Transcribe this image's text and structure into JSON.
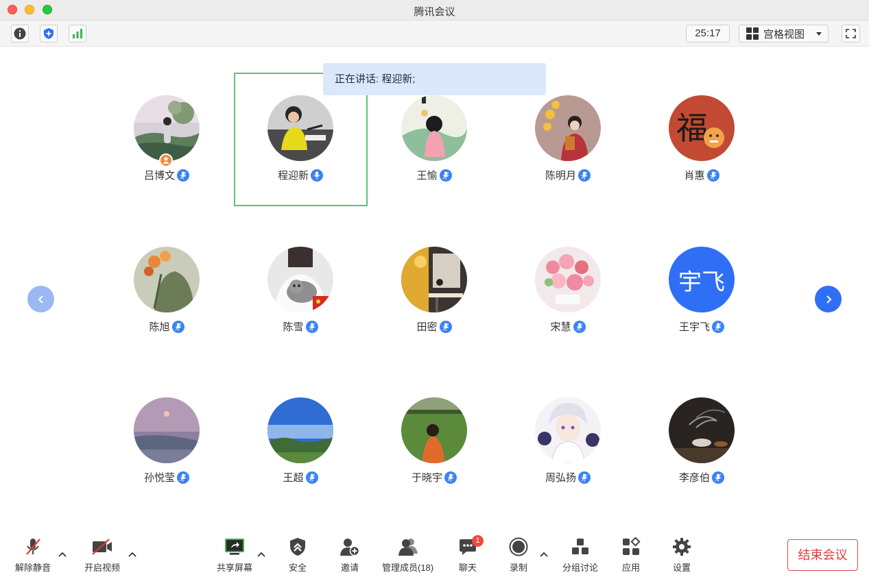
{
  "window": {
    "title": "腾讯会议"
  },
  "toolbar": {
    "timer": "25:17",
    "view_mode": "宫格视图"
  },
  "speaking_banner": "正在讲话: 程迎新;",
  "participants": [
    {
      "name": "吕博文",
      "avatar": "landscape-photo",
      "host": true
    },
    {
      "name": "程迎新",
      "avatar": "person-photo",
      "speaking": true
    },
    {
      "name": "王愉",
      "avatar": "illustration"
    },
    {
      "name": "陈明月",
      "avatar": "illustration"
    },
    {
      "name": "肖惠",
      "avatar": "fu-character"
    },
    {
      "name": "陈旭",
      "avatar": "flowers-photo"
    },
    {
      "name": "陈雪",
      "avatar": "cat-photo"
    },
    {
      "name": "田密",
      "avatar": "illustration"
    },
    {
      "name": "宋慧",
      "avatar": "flowers-photo"
    },
    {
      "name": "王宇飞",
      "avatar": "text-initials",
      "initials": "宇飞"
    },
    {
      "name": "孙悦莹",
      "avatar": "sunset-photo"
    },
    {
      "name": "王超",
      "avatar": "sky-photo"
    },
    {
      "name": "于晓宇",
      "avatar": "grass-photo"
    },
    {
      "name": "周弘扬",
      "avatar": "anime"
    },
    {
      "name": "李彦伯",
      "avatar": "tea-photo"
    }
  ],
  "bottom": {
    "unmute": "解除静音",
    "video": "开启视频",
    "share": "共享屏幕",
    "security": "安全",
    "invite": "邀请",
    "members": "管理成员(18)",
    "chat": "聊天",
    "chat_badge": "1",
    "record": "录制",
    "breakout": "分组讨论",
    "apps": "应用",
    "settings": "设置",
    "end": "结束会议"
  },
  "colors": {
    "accent": "#2f6ff5",
    "speaking_border": "#5dc27a",
    "end_red": "#e03a3a"
  }
}
